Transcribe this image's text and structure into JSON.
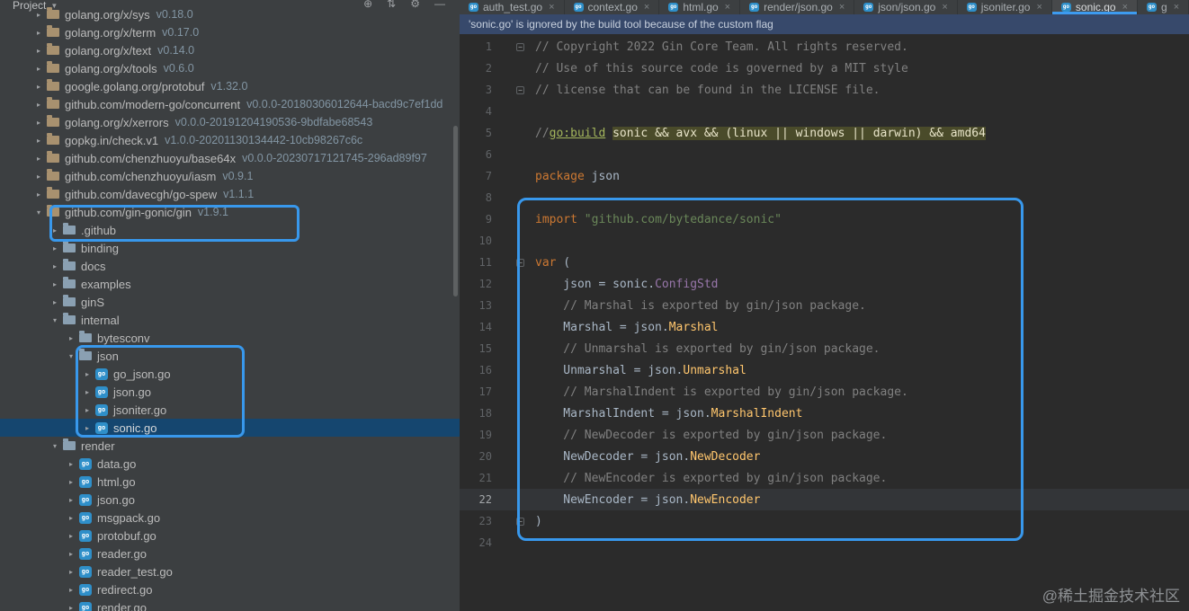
{
  "project_panel": {
    "title": "Project",
    "toolbar": [
      {
        "name": "locate-icon",
        "glyph": "⊕"
      },
      {
        "name": "collapse-all-icon",
        "glyph": "⇅"
      },
      {
        "name": "settings-icon",
        "glyph": "⚙"
      },
      {
        "name": "hide-icon",
        "glyph": "—"
      }
    ],
    "tree": [
      {
        "label": "golang.org/x/sys",
        "version": "v0.18.0",
        "depth": 0,
        "kind": "module",
        "state": "collapsed"
      },
      {
        "label": "golang.org/x/term",
        "version": "v0.17.0",
        "depth": 0,
        "kind": "module",
        "state": "collapsed"
      },
      {
        "label": "golang.org/x/text",
        "version": "v0.14.0",
        "depth": 0,
        "kind": "module",
        "state": "collapsed"
      },
      {
        "label": "golang.org/x/tools",
        "version": "v0.6.0",
        "depth": 0,
        "kind": "module",
        "state": "collapsed"
      },
      {
        "label": "google.golang.org/protobuf",
        "version": "v1.32.0",
        "depth": 0,
        "kind": "module",
        "state": "collapsed"
      },
      {
        "label": "github.com/modern-go/concurrent",
        "version": "v0.0.0-20180306012644-bacd9c7ef1dd",
        "depth": 0,
        "kind": "module",
        "state": "collapsed"
      },
      {
        "label": "golang.org/x/xerrors",
        "version": "v0.0.0-20191204190536-9bdfabe68543",
        "depth": 0,
        "kind": "module",
        "state": "collapsed"
      },
      {
        "label": "gopkg.in/check.v1",
        "version": "v1.0.0-20201130134442-10cb98267c6c",
        "depth": 0,
        "kind": "module",
        "state": "collapsed"
      },
      {
        "label": "github.com/chenzhuoyu/base64x",
        "version": "v0.0.0-20230717121745-296ad89f97",
        "depth": 0,
        "kind": "module",
        "state": "collapsed"
      },
      {
        "label": "github.com/chenzhuoyu/iasm",
        "version": "v0.9.1",
        "depth": 0,
        "kind": "module",
        "state": "collapsed"
      },
      {
        "label": "github.com/davecgh/go-spew",
        "version": "v1.1.1",
        "depth": 0,
        "kind": "module",
        "state": "collapsed"
      },
      {
        "label": "github.com/gin-gonic/gin",
        "version": "v1.9.1",
        "depth": 0,
        "kind": "module",
        "state": "expanded"
      },
      {
        "label": ".github",
        "depth": 1,
        "kind": "dir",
        "state": "collapsed"
      },
      {
        "label": "binding",
        "depth": 1,
        "kind": "dir",
        "state": "collapsed"
      },
      {
        "label": "docs",
        "depth": 1,
        "kind": "dir",
        "state": "collapsed"
      },
      {
        "label": "examples",
        "depth": 1,
        "kind": "dir",
        "state": "collapsed"
      },
      {
        "label": "ginS",
        "depth": 1,
        "kind": "dir",
        "state": "collapsed"
      },
      {
        "label": "internal",
        "depth": 1,
        "kind": "dir",
        "state": "expanded"
      },
      {
        "label": "bytesconv",
        "depth": 2,
        "kind": "dir",
        "state": "collapsed"
      },
      {
        "label": "json",
        "depth": 2,
        "kind": "dir",
        "state": "expanded"
      },
      {
        "label": "go_json.go",
        "depth": 3,
        "kind": "gofile",
        "state": "collapsed"
      },
      {
        "label": "json.go",
        "depth": 3,
        "kind": "gofile",
        "state": "collapsed"
      },
      {
        "label": "jsoniter.go",
        "depth": 3,
        "kind": "gofile",
        "state": "collapsed"
      },
      {
        "label": "sonic.go",
        "depth": 3,
        "kind": "gofile",
        "state": "collapsed",
        "selected": true
      },
      {
        "label": "render",
        "depth": 1,
        "kind": "dir",
        "state": "expanded"
      },
      {
        "label": "data.go",
        "depth": 2,
        "kind": "gofile",
        "state": "collapsed"
      },
      {
        "label": "html.go",
        "depth": 2,
        "kind": "gofile",
        "state": "collapsed"
      },
      {
        "label": "json.go",
        "depth": 2,
        "kind": "gofile",
        "state": "collapsed"
      },
      {
        "label": "msgpack.go",
        "depth": 2,
        "kind": "gofile",
        "state": "collapsed"
      },
      {
        "label": "protobuf.go",
        "depth": 2,
        "kind": "gofile",
        "state": "collapsed"
      },
      {
        "label": "reader.go",
        "depth": 2,
        "kind": "gofile",
        "state": "collapsed"
      },
      {
        "label": "reader_test.go",
        "depth": 2,
        "kind": "gofile",
        "state": "collapsed"
      },
      {
        "label": "redirect.go",
        "depth": 2,
        "kind": "gofile",
        "state": "collapsed"
      },
      {
        "label": "render.go",
        "depth": 2,
        "kind": "gofile",
        "state": "collapsed"
      }
    ]
  },
  "tabs": [
    {
      "label": "auth_test.go",
      "active": false
    },
    {
      "label": "context.go",
      "active": false
    },
    {
      "label": "html.go",
      "active": false
    },
    {
      "label": "render/json.go",
      "active": false
    },
    {
      "label": "json/json.go",
      "active": false
    },
    {
      "label": "jsoniter.go",
      "active": false
    },
    {
      "label": "sonic.go",
      "active": true
    },
    {
      "label": "g",
      "active": false
    }
  ],
  "editor": {
    "notification": "'sonic.go' is ignored by the build tool because of the custom flag",
    "lines": [
      {
        "n": 1,
        "fold": true,
        "tokens": [
          [
            "com",
            "// Copyright 2022 Gin Core Team. All rights reserved."
          ]
        ]
      },
      {
        "n": 2,
        "tokens": [
          [
            "com",
            "// Use of this source code is governed by a MIT style"
          ]
        ]
      },
      {
        "n": 3,
        "fold": true,
        "tokens": [
          [
            "com",
            "// license that can be found in the LICENSE file."
          ]
        ]
      },
      {
        "n": 4,
        "tokens": []
      },
      {
        "n": 5,
        "tokens": [
          [
            "com",
            "//"
          ],
          [
            "bt",
            "go:build"
          ],
          [
            "pl",
            " "
          ],
          [
            "frag",
            "sonic && avx && (linux || windows || darwin) && amd64"
          ]
        ]
      },
      {
        "n": 6,
        "tokens": []
      },
      {
        "n": 7,
        "tokens": [
          [
            "kw",
            "package"
          ],
          [
            "pl",
            " json"
          ]
        ]
      },
      {
        "n": 8,
        "tokens": []
      },
      {
        "n": 9,
        "tokens": [
          [
            "kw",
            "import"
          ],
          [
            "pl",
            " "
          ],
          [
            "str",
            "\"github.com/bytedance/sonic\""
          ]
        ]
      },
      {
        "n": 10,
        "tokens": []
      },
      {
        "n": 11,
        "fold": true,
        "tokens": [
          [
            "kw",
            "var"
          ],
          [
            "pl",
            " ("
          ]
        ]
      },
      {
        "n": 12,
        "tokens": [
          [
            "pl",
            "    json = sonic."
          ],
          [
            "fd",
            "ConfigStd"
          ]
        ]
      },
      {
        "n": 13,
        "tokens": [
          [
            "com",
            "    // Marshal is exported by gin/json package."
          ]
        ]
      },
      {
        "n": 14,
        "tokens": [
          [
            "pl",
            "    Marshal = json."
          ],
          [
            "fn",
            "Marshal"
          ]
        ]
      },
      {
        "n": 15,
        "tokens": [
          [
            "com",
            "    // Unmarshal is exported by gin/json package."
          ]
        ]
      },
      {
        "n": 16,
        "tokens": [
          [
            "pl",
            "    Unmarshal = json."
          ],
          [
            "fn",
            "Unmarshal"
          ]
        ]
      },
      {
        "n": 17,
        "tokens": [
          [
            "com",
            "    // MarshalIndent is exported by gin/json package."
          ]
        ]
      },
      {
        "n": 18,
        "tokens": [
          [
            "pl",
            "    MarshalIndent = json."
          ],
          [
            "fn",
            "MarshalIndent"
          ]
        ]
      },
      {
        "n": 19,
        "tokens": [
          [
            "com",
            "    // NewDecoder is exported by gin/json package."
          ]
        ]
      },
      {
        "n": 20,
        "tokens": [
          [
            "pl",
            "    NewDecoder = json."
          ],
          [
            "fn",
            "NewDecoder"
          ]
        ]
      },
      {
        "n": 21,
        "tokens": [
          [
            "com",
            "    // NewEncoder is exported by gin/json package."
          ]
        ]
      },
      {
        "n": 22,
        "current": true,
        "tokens": [
          [
            "pl",
            "    NewEncoder = json."
          ],
          [
            "fn",
            "NewEncoder"
          ]
        ]
      },
      {
        "n": 23,
        "fold": true,
        "tokens": [
          [
            "pl",
            ")"
          ]
        ]
      },
      {
        "n": 24,
        "tokens": []
      }
    ]
  },
  "colors": {
    "annotation_blue": "#3898EC",
    "selection_blue": "#15466F",
    "panel_bg": "#3C3F41",
    "editor_bg": "#2B2B2B",
    "notification_bg": "#37496B"
  },
  "watermark": "@稀土掘金技术社区"
}
